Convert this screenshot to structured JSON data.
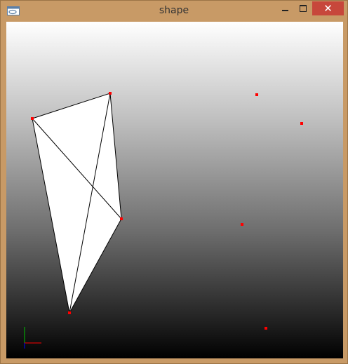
{
  "window": {
    "title": "shape",
    "close_glyph": "✕"
  },
  "icons": {
    "app": "app-icon",
    "minimize": "minimize-icon",
    "maximize": "maximize-icon",
    "close": "close-icon",
    "axes": "axes-icon"
  },
  "colors": {
    "control_point": "#ff0000",
    "shape_fill": "#ffffff",
    "shape_edge": "#000000",
    "close_button": "#c7473b",
    "axis_x": "#ff0000",
    "axis_y": "#00c000",
    "axis_z": "#0000ff"
  }
}
